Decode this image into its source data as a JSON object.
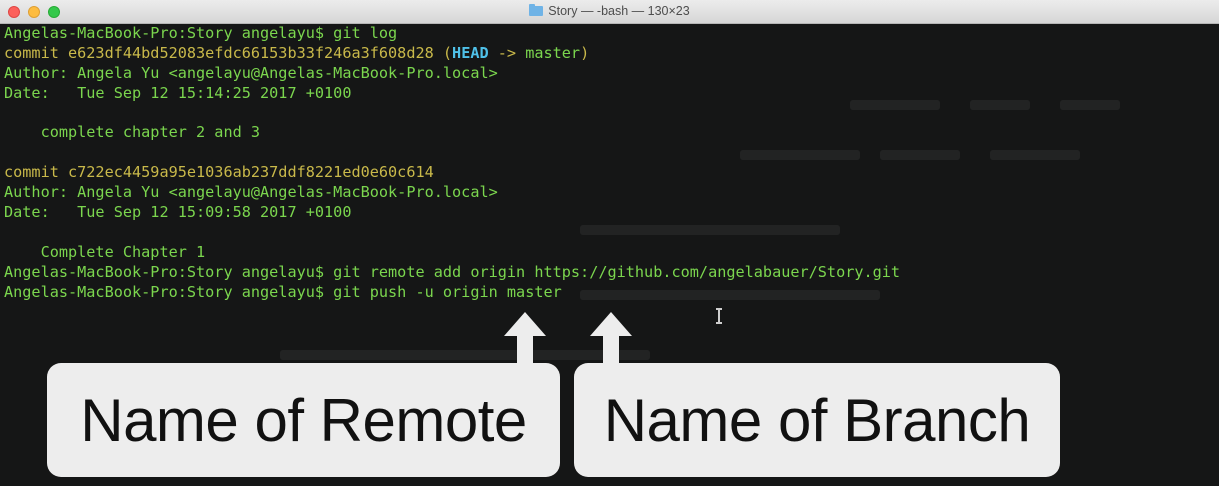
{
  "window": {
    "title": "Story — -bash — 130×23",
    "folder_icon": "folder-icon"
  },
  "terminal": {
    "prompt": "Angelas-MacBook-Pro:Story angelayu$",
    "cmd_log": " git log",
    "commit1": {
      "label": "commit e623df44bd52083efdc66153b33f246a3f608d28 (",
      "head": "HEAD",
      "arrow": " -> ",
      "branch": "master",
      "close": ")",
      "author": "Author: Angela Yu <angelayu@Angelas-MacBook-Pro.local>",
      "date": "Date:   Tue Sep 12 15:14:25 2017 +0100",
      "message": "    complete chapter 2 and 3"
    },
    "commit2": {
      "label": "commit c722ec4459a95e1036ab237ddf8221ed0e60c614",
      "author": "Author: Angela Yu <angelayu@Angelas-MacBook-Pro.local>",
      "date": "Date:   Tue Sep 12 15:09:58 2017 +0100",
      "message": "    Complete Chapter 1"
    },
    "cmd_remote": " git remote add origin https://github.com/angelabauer/Story.git",
    "cmd_push": " git push -u origin master"
  },
  "annotations": {
    "remote_label": "Name of Remote",
    "branch_label": "Name of Branch"
  },
  "colors": {
    "terminal_bg": "#151616",
    "text_green": "#7bd64e",
    "commit_yellow": "#c9b94a",
    "head_cyan": "#4fc1e9",
    "callout_bg": "#ededed"
  }
}
